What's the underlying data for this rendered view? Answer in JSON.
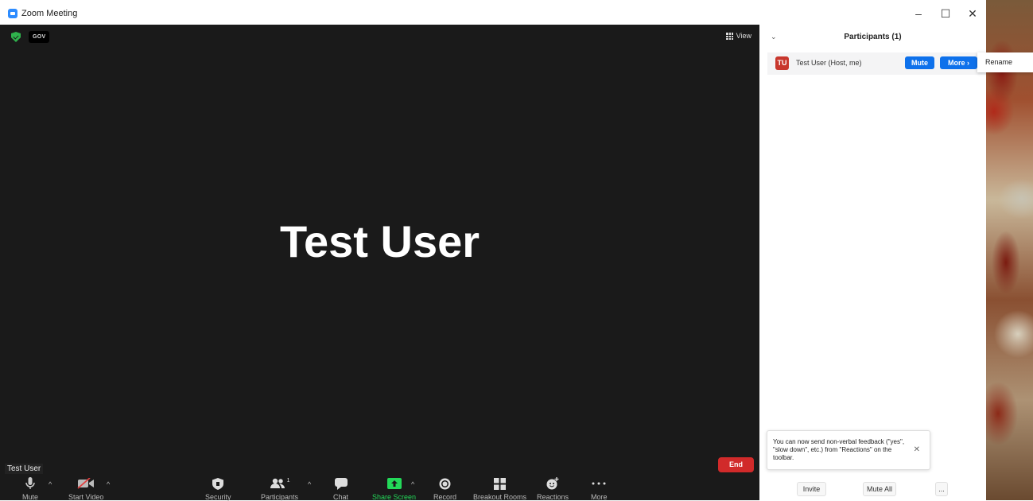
{
  "window": {
    "title": "Zoom Meeting",
    "minimize": "–",
    "maximize": "☐",
    "close": "✕"
  },
  "meeting": {
    "badge": "GOV",
    "view_label": "View",
    "participant_name": "Test User",
    "name_tag": "Test User"
  },
  "toolbar": {
    "mute": "Mute",
    "start_video": "Start Video",
    "security": "Security",
    "participants": "Participants",
    "participants_count": "1",
    "chat": "Chat",
    "share_screen": "Share Screen",
    "record": "Record",
    "breakout_rooms": "Breakout Rooms",
    "reactions": "Reactions",
    "more": "More",
    "end": "End"
  },
  "panel": {
    "title": "Participants (1)",
    "participant": {
      "initials": "TU",
      "name": "Test User (Host, me)",
      "mute_label": "Mute",
      "more_label": "More ›"
    },
    "popup_item": "Rename",
    "tip": "You can now send non-verbal feedback (\"yes\", \"slow down\", etc.) from \"Reactions\" on the toolbar.",
    "invite": "Invite",
    "mute_all": "Mute All",
    "ellipsis": "..."
  },
  "colors": {
    "share_green": "#23d959",
    "end_red": "#d12a2a",
    "mute_blue": "#0e71eb",
    "avatar_red": "#c8372d"
  }
}
